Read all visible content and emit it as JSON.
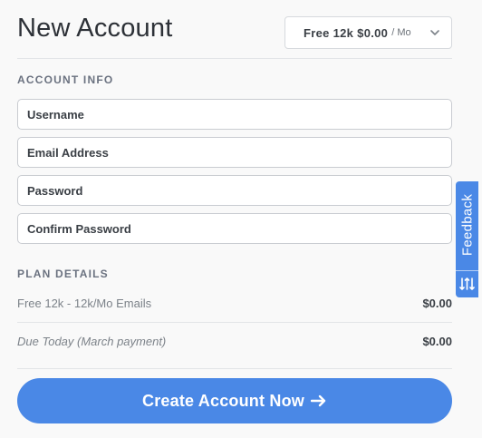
{
  "header": {
    "title": "New Account",
    "plan_select": {
      "name": "Free 12k",
      "price": "$0.00",
      "per": "/ Mo",
      "icon": "chevron-down-icon"
    }
  },
  "account_info": {
    "label": "ACCOUNT INFO",
    "fields": {
      "username": {
        "placeholder": "Username",
        "value": ""
      },
      "email": {
        "placeholder": "Email Address",
        "value": ""
      },
      "password": {
        "placeholder": "Password",
        "value": ""
      },
      "confirm_password": {
        "placeholder": "Confirm Password",
        "value": ""
      }
    }
  },
  "plan_details": {
    "label": "PLAN DETAILS",
    "rows": [
      {
        "label": "Free 12k - 12k/Mo Emails",
        "value": "$0.00"
      },
      {
        "label": "Due Today (March payment)",
        "value": "$0.00"
      }
    ]
  },
  "cta": {
    "label": "Create Account Now",
    "icon": "arrow-right-icon",
    "color": "#4a88e6"
  },
  "feedback": {
    "label": "Feedback",
    "icon": "sort-arrows-icon",
    "color": "#4a88e6"
  }
}
